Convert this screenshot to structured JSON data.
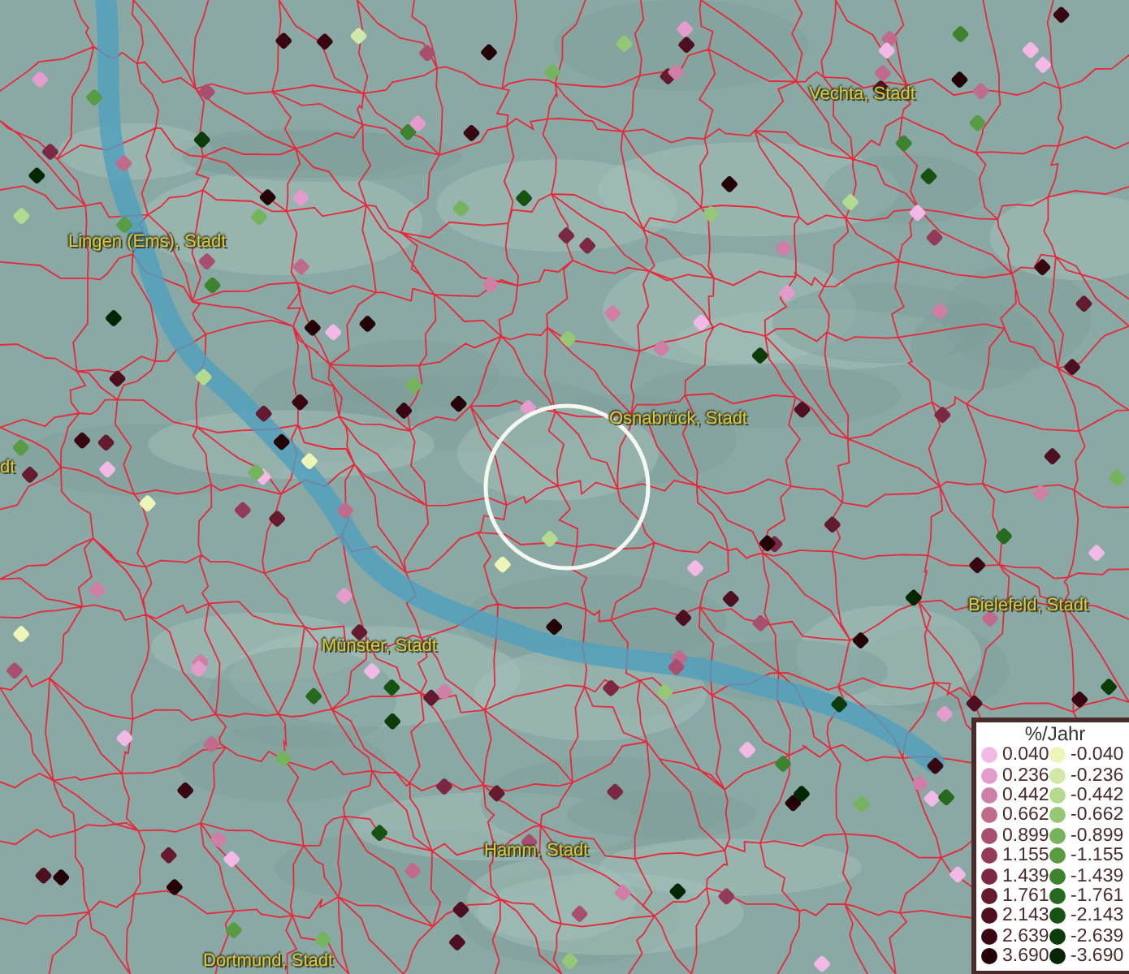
{
  "map": {
    "place_labels": [
      {
        "name": "Vechta, Stadt"
      },
      {
        "name": "Lingen (Ems), Stadt"
      },
      {
        "name": "dt"
      },
      {
        "name": "Osnabrück, Stadt"
      },
      {
        "name": "Bielefeld, Stadt"
      },
      {
        "name": "Münster, Stadt"
      },
      {
        "name": "Hamm, Stadt"
      },
      {
        "name": "Dortmund, Stadt"
      }
    ]
  },
  "legend": {
    "title": "%/Jahr",
    "rows": [
      {
        "positive": {
          "value": "0.040",
          "color": "#f2b8e6"
        },
        "negative": {
          "value": "-0.040",
          "color": "#eef5b8"
        }
      },
      {
        "positive": {
          "value": "0.236",
          "color": "#e39ccb"
        },
        "negative": {
          "value": "-0.236",
          "color": "#d2e8a8"
        }
      },
      {
        "positive": {
          "value": "0.442",
          "color": "#cf7fa6"
        },
        "negative": {
          "value": "-0.442",
          "color": "#b3da8e"
        }
      },
      {
        "positive": {
          "value": "0.662",
          "color": "#c06a8c"
        },
        "negative": {
          "value": "-0.662",
          "color": "#94c877"
        }
      },
      {
        "positive": {
          "value": "0.899",
          "color": "#a84e6e"
        },
        "negative": {
          "value": "-0.899",
          "color": "#75b35c"
        }
      },
      {
        "positive": {
          "value": "1.155",
          "color": "#923a58"
        },
        "negative": {
          "value": "-1.155",
          "color": "#579b43"
        }
      },
      {
        "positive": {
          "value": "1.439",
          "color": "#7c2842"
        },
        "negative": {
          "value": "-1.439",
          "color": "#3c822f"
        }
      },
      {
        "positive": {
          "value": "1.761",
          "color": "#661a30"
        },
        "negative": {
          "value": "-1.761",
          "color": "#266a1f"
        }
      },
      {
        "positive": {
          "value": "2.143",
          "color": "#4e0f20"
        },
        "negative": {
          "value": "-2.143",
          "color": "#165212"
        }
      },
      {
        "positive": {
          "value": "2.639",
          "color": "#380712"
        },
        "negative": {
          "value": "-2.639",
          "color": "#0b3c09"
        }
      },
      {
        "positive": {
          "value": "3.690",
          "color": "#240308"
        },
        "negative": {
          "value": "-3.690",
          "color": "#042604"
        }
      }
    ]
  }
}
